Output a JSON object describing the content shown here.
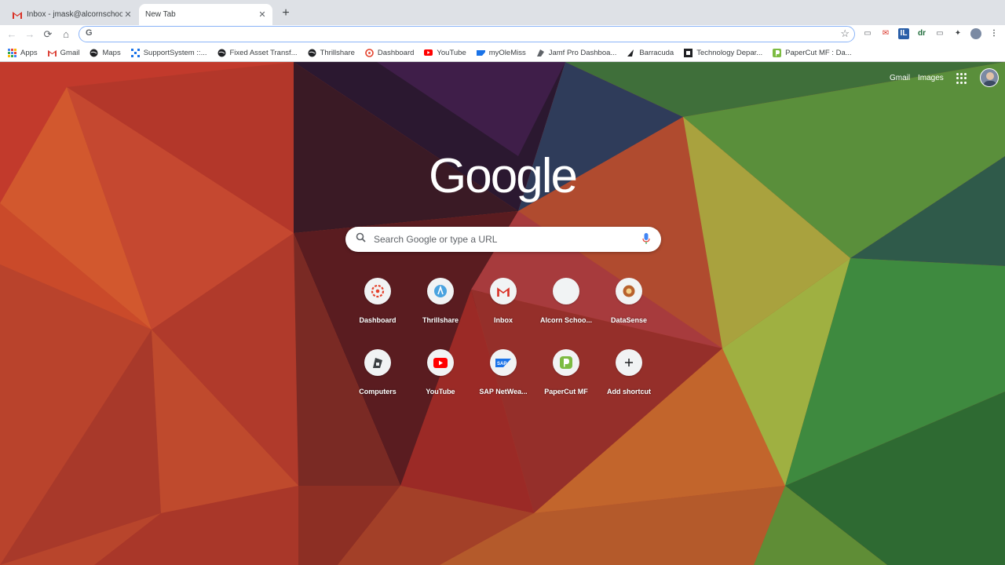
{
  "tabs": [
    {
      "title": "Inbox - jmask@alcornschools.o",
      "icon": "gmail-icon"
    },
    {
      "title": "New Tab",
      "icon": ""
    }
  ],
  "omnibox": {
    "value": "",
    "placeholder": ""
  },
  "bookmarks": [
    {
      "label": "Apps",
      "icon": "apps-icon"
    },
    {
      "label": "Gmail",
      "icon": "gmail-icon"
    },
    {
      "label": "Maps",
      "icon": "globe-icon"
    },
    {
      "label": "SupportSystem ::...",
      "icon": "support-icon"
    },
    {
      "label": "Fixed Asset Transf...",
      "icon": "globe-icon"
    },
    {
      "label": "Thrillshare",
      "icon": "globe-icon"
    },
    {
      "label": "Dashboard",
      "icon": "canvas-icon"
    },
    {
      "label": "YouTube",
      "icon": "youtube-icon"
    },
    {
      "label": "myOleMiss",
      "icon": "sap-icon"
    },
    {
      "label": "Jamf Pro Dashboa...",
      "icon": "jamf-icon"
    },
    {
      "label": "Barracuda",
      "icon": "barracuda-icon"
    },
    {
      "label": "Technology Depar...",
      "icon": "techdept-icon"
    },
    {
      "label": "PaperCut MF : Da...",
      "icon": "papercut-icon"
    }
  ],
  "header": {
    "gmail": "Gmail",
    "images": "Images"
  },
  "logo": "Google",
  "search": {
    "placeholder": "Search Google or type a URL"
  },
  "shortcuts": [
    {
      "label": "Dashboard",
      "icon": "canvas-icon"
    },
    {
      "label": "Thrillshare",
      "icon": "thrillshare-icon"
    },
    {
      "label": "Inbox",
      "icon": "gmail-icon"
    },
    {
      "label": "Alcorn Schoo...",
      "icon": "blank-icon"
    },
    {
      "label": "DataSense",
      "icon": "datasense-icon"
    },
    {
      "label": "Computers",
      "icon": "jamf-icon"
    },
    {
      "label": "YouTube",
      "icon": "youtube-icon"
    },
    {
      "label": "SAP NetWea...",
      "icon": "sap-icon"
    },
    {
      "label": "PaperCut MF",
      "icon": "papercut-icon"
    },
    {
      "label": "Add shortcut",
      "icon": "plus-icon"
    }
  ],
  "colors": {
    "accent": "#8ab4f8",
    "gmail_red": "#d93025",
    "youtube_red": "#ff0000",
    "papercut_green": "#7cbb42"
  }
}
